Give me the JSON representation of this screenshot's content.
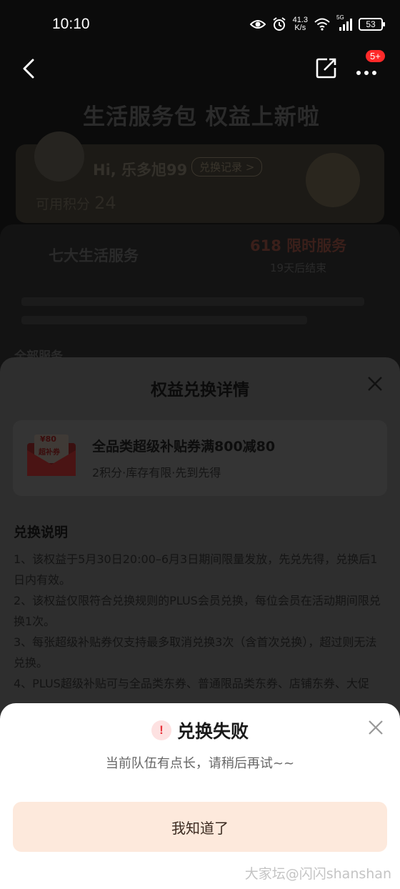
{
  "status_bar": {
    "time": "10:10",
    "speed_value": "41.3",
    "speed_unit": "K/s",
    "network": "5G",
    "battery": "53"
  },
  "nav": {
    "badge": "5+"
  },
  "background": {
    "banner_title": "生活服务包 权益上新啦",
    "greeting": "Hi, 乐多旭99",
    "record_link": "兑换记录 >",
    "points_label": "可用积分",
    "points_value": "24",
    "tab_left": "七大生活服务",
    "tab_right": "618 限时服务",
    "tab_right_sub": "19天后结束",
    "all_services": "全部服务"
  },
  "detail": {
    "title": "权益兑换详情",
    "coupon": {
      "amount": "¥80",
      "tag": "超补券",
      "name": "全品类超级补贴券满800减80",
      "sub": "2积分·库存有限·先到先得"
    },
    "rules_title": "兑换说明",
    "rules": [
      "1、该权益于5月30日20:00–6月3日期间限量发放，先兑先得，兑换后1日内有效。",
      "2、该权益仅限符合兑换规则的PLUS会员兑换，每位会员在活动期间限兑换1次。",
      "3、每张超级补贴券仅支持最多取消兑换3次（含首次兑换），超过则无法兑换。",
      "4、PLUS超级补贴可与全品类东券、普通限品类东券、店铺东券、大促"
    ]
  },
  "dialog": {
    "icon": "!",
    "title": "兑换失败",
    "message": "当前队伍有点长，请稍后再试~~",
    "button": "我知道了"
  },
  "watermark": "大家坛@闪闪shanshan"
}
